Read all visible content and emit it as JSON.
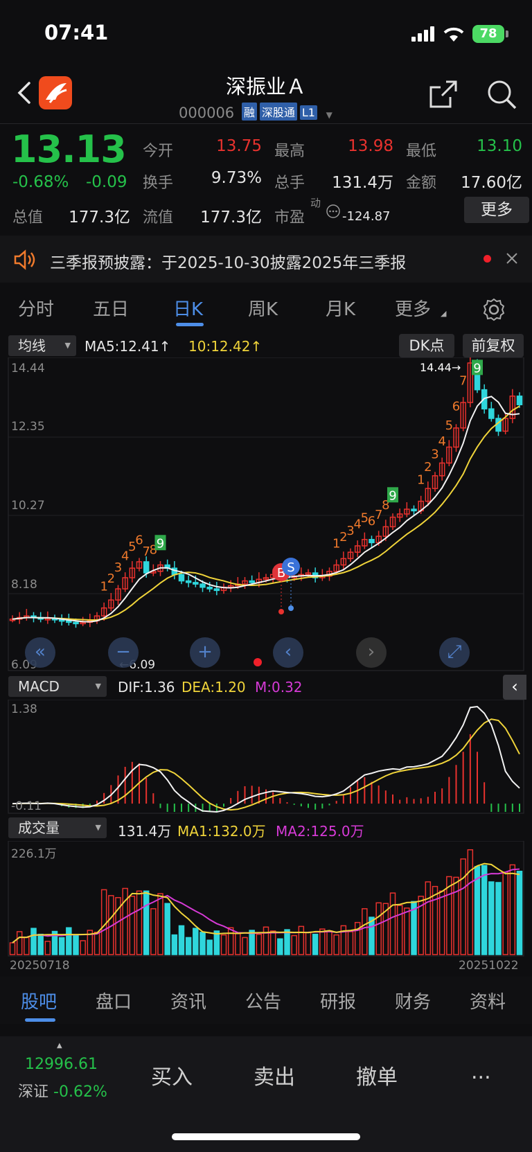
{
  "status_bar": {
    "time": "07:41",
    "battery": "78"
  },
  "header": {
    "title": "深振业Ａ",
    "code": "000006",
    "tags": [
      "融",
      "深股通",
      "L1"
    ]
  },
  "quote": {
    "price": "13.13",
    "change_pct": "-0.68%",
    "change": "-0.09",
    "rows": [
      [
        {
          "label": "今开",
          "value": "13.75",
          "color": "#e8322e"
        },
        {
          "label": "最高",
          "value": "13.98",
          "color": "#e8322e"
        },
        {
          "label": "最低",
          "value": "13.10",
          "color": "#25c14a"
        }
      ],
      [
        {
          "label": "换手",
          "value": "9.73%",
          "color": "#e6e6e6"
        },
        {
          "label": "总手",
          "value": "131.4万",
          "color": "#e6e6e6"
        },
        {
          "label": "金额",
          "value": "17.60亿",
          "color": "#e6e6e6"
        }
      ]
    ],
    "total_value_label": "总值",
    "total_value": "177.3亿",
    "float_value_label": "流值",
    "float_value": "177.3亿",
    "pe_label": "市盈",
    "pe_sup": "动",
    "pe_value": "-124.87",
    "more_label": "更多"
  },
  "notice": {
    "text": "三季报预披露：于2025-10-30披露2025年三季报"
  },
  "tabs": [
    {
      "label": "分时",
      "active": false
    },
    {
      "label": "五日",
      "active": false
    },
    {
      "label": "日K",
      "active": true
    },
    {
      "label": "周K",
      "active": false
    },
    {
      "label": "月K",
      "active": false
    },
    {
      "label": "更多",
      "active": false
    }
  ],
  "kline": {
    "indicator_select": "均线",
    "ma5_text": "MA5:12.41",
    "ma10_text": "10:12.42",
    "dk_label": "DK点",
    "adjust_label": "前复权",
    "y_labels": [
      "14.44",
      "12.35",
      "10.27",
      "8.18"
    ],
    "bottom_left_label": "6.09",
    "low_partial": "6.09",
    "high_marker": "14.44",
    "buy_marker": "B",
    "sell_marker": "S"
  },
  "macd": {
    "select": "MACD",
    "dif": "DIF:1.36",
    "dea": "DEA:1.20",
    "m": "M:0.32",
    "top": "1.38",
    "bottom": "-0.11"
  },
  "volume": {
    "select": "成交量",
    "value": "131.4万",
    "ma1": "MA1:132.0万",
    "ma2": "MA2:125.0万",
    "top": "226.1万",
    "date_start": "20250718",
    "date_end": "20251022"
  },
  "chart_data": {
    "type": "candlestick",
    "date_start": "20250718",
    "date_end": "20251022",
    "y_axis_ticks": [
      14.44,
      12.35,
      10.27,
      8.18
    ],
    "y_range": [
      6.09,
      14.44
    ],
    "close_approx": [
      6.4,
      6.45,
      6.5,
      6.45,
      6.4,
      6.42,
      6.38,
      6.35,
      6.3,
      6.28,
      6.3,
      6.35,
      6.5,
      6.75,
      7.0,
      7.35,
      7.7,
      8.0,
      8.2,
      7.85,
      7.9,
      8.1,
      8.0,
      7.8,
      7.6,
      7.55,
      7.5,
      7.4,
      7.35,
      7.3,
      7.4,
      7.45,
      7.5,
      7.6,
      7.55,
      7.65,
      7.7,
      7.8,
      7.75,
      7.7,
      7.75,
      7.8,
      7.85,
      7.7,
      7.75,
      7.9,
      8.1,
      8.3,
      8.5,
      8.7,
      8.9,
      8.8,
      9.0,
      9.3,
      9.6,
      9.7,
      9.85,
      9.8,
      10.1,
      10.5,
      10.9,
      11.3,
      11.8,
      12.4,
      13.2,
      14.44,
      13.6,
      13.0,
      12.7,
      12.3,
      12.7,
      13.4,
      13.13
    ]
  },
  "bottom_tabs": [
    {
      "label": "股吧",
      "active": true
    },
    {
      "label": "盘口",
      "active": false
    },
    {
      "label": "资讯",
      "active": false
    },
    {
      "label": "公告",
      "active": false
    },
    {
      "label": "研报",
      "active": false
    },
    {
      "label": "财务",
      "active": false
    },
    {
      "label": "资料",
      "active": false
    }
  ],
  "footer": {
    "index_value": "12996.61",
    "index_name": "深证",
    "index_change": "-0.62%",
    "buy": "买入",
    "sell": "卖出",
    "cancel": "撤单",
    "more": "..."
  }
}
